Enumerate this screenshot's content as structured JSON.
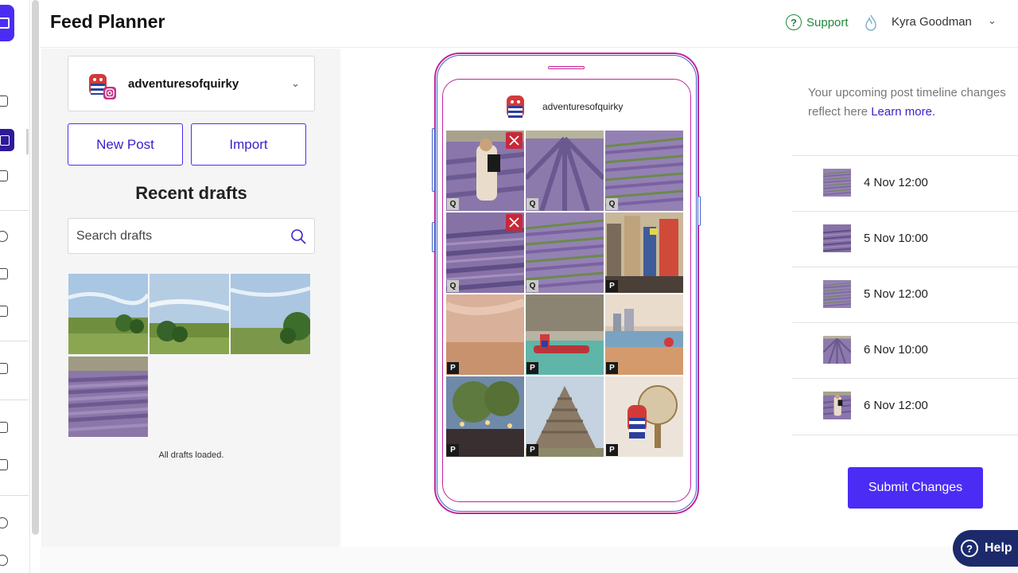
{
  "header": {
    "title": "Feed Planner",
    "support_label": "Support",
    "user_name": "Kyra Goodman"
  },
  "sidebar": {
    "icons": [
      "calendar-icon",
      "grid-icon",
      "list-icon",
      "clock-icon",
      "bag-icon",
      "bell-icon",
      "chart-icon",
      "tag-icon",
      "layers-icon",
      "share-icon",
      "user-icon"
    ]
  },
  "left": {
    "account_name": "adventuresofquirky",
    "new_post_label": "New Post",
    "import_label": "Import",
    "recent_title": "Recent drafts",
    "search_placeholder": "Search drafts",
    "drafts_status": "All drafts loaded."
  },
  "feed": {
    "account_name": "adventuresofquirky",
    "tiles": [
      {
        "scene": "lavender-person",
        "badge": "Q",
        "removable": true
      },
      {
        "scene": "lavender-rows",
        "badge": "Q",
        "removable": false
      },
      {
        "scene": "lavender-close",
        "badge": "Q",
        "removable": false
      },
      {
        "scene": "lavender-field",
        "badge": "Q",
        "removable": true
      },
      {
        "scene": "lavender-close",
        "badge": "Q",
        "removable": false
      },
      {
        "scene": "city",
        "badge": "P",
        "removable": false
      },
      {
        "scene": "beach",
        "badge": "P",
        "removable": false
      },
      {
        "scene": "boat",
        "badge": "P",
        "removable": false
      },
      {
        "scene": "coast",
        "badge": "P",
        "removable": false
      },
      {
        "scene": "night-market",
        "badge": "P",
        "removable": false
      },
      {
        "scene": "pyramid",
        "badge": "P",
        "removable": false
      },
      {
        "scene": "globe",
        "badge": "P",
        "removable": false
      }
    ]
  },
  "right": {
    "note": "Your upcoming post timeline changes reflect here",
    "learn_more": "Learn more.",
    "timeline": [
      {
        "time": "4 Nov 12:00"
      },
      {
        "time": "5 Nov 10:00"
      },
      {
        "time": "5 Nov 12:00"
      },
      {
        "time": "6 Nov 10:00"
      },
      {
        "time": "6 Nov 12:00"
      }
    ],
    "submit_label": "Submit Changes",
    "help_label": "Help"
  },
  "colors": {
    "accent": "#4b2cf5",
    "support_green": "#1f8a3b",
    "phone_pink": "#c3259b",
    "phone_blue": "#4260c8",
    "remove_red": "#c8283a"
  }
}
